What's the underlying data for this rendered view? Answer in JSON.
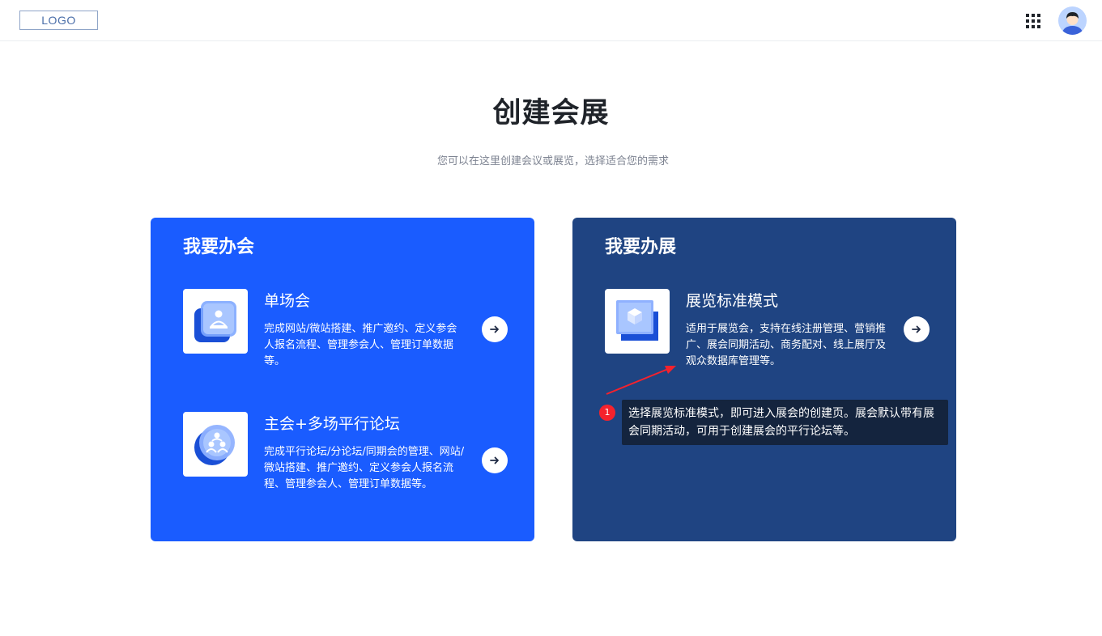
{
  "header": {
    "logo": "LOGO",
    "apps_icon": "grid-apps-icon",
    "avatar_icon": "user-avatar"
  },
  "page": {
    "title": "创建会展",
    "subtitle": "您可以在这里创建会议或展览，选择适合您的需求"
  },
  "meeting_card": {
    "title": "我要办会",
    "color": "#1a5cff",
    "options": [
      {
        "name": "单场会",
        "desc": "完成网站/微站搭建、推广邀约、定义参会人报名流程、管理参会人、管理订单数据等。",
        "icon": "single-meeting-icon"
      },
      {
        "name": "主会+多场平行论坛",
        "desc": "完成平行论坛/分论坛/同期会的管理、网站/微站搭建、推广邀约、定义参会人报名流程、管理参会人、管理订单数据等。",
        "icon": "multi-forum-icon"
      }
    ]
  },
  "expo_card": {
    "title": "我要办展",
    "color": "#1f4482",
    "options": [
      {
        "name": "展览标准模式",
        "desc": "适用于展览会，支持在线注册管理、营销推广、展会同期活动、商务配对、线上展厅及观众数据库管理等。",
        "icon": "expo-box-icon"
      }
    ]
  },
  "guide": {
    "step": "1",
    "text": "选择展览标准模式，即可进入展会的创建页。展会默认带有展会同期活动，可用于创建展会的平行论坛等。",
    "color": "#f5222d"
  }
}
